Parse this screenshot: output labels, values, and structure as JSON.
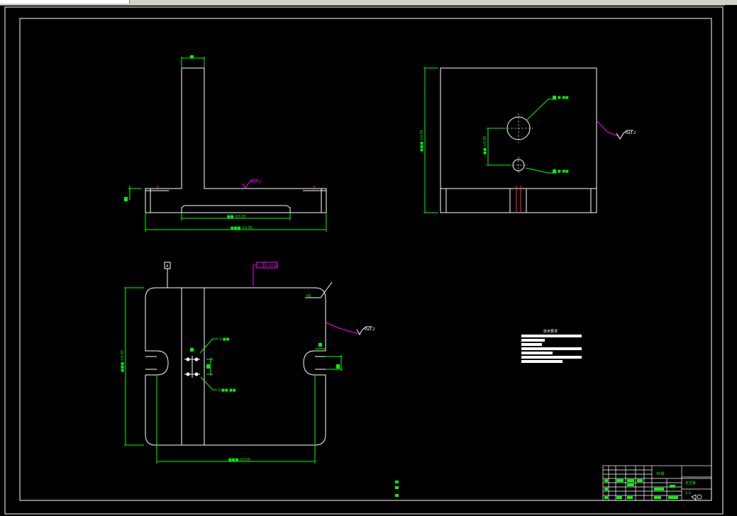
{
  "window": {
    "title": ""
  },
  "colors": {
    "background": "#000000",
    "geometry": "#ffffff",
    "dimension": "#00ff00",
    "annotation": "#ff00ff",
    "ui_chrome": "#d4d0c8"
  },
  "views": {
    "front": {
      "dim_inner": "■■ ±0.05",
      "dim_outer": "■■■ ±0.05",
      "roughness": "Ra3.2"
    },
    "side": {
      "dim_height": "■■■ ±0.05",
      "hole_top": "■ ■■",
      "hole_bottom": "■ ■■",
      "hole_spacing": "■■ ±0.05",
      "roughness": "Ra3.2"
    },
    "top": {
      "datum": "A",
      "flatness": "0.02 A",
      "roughness_right": "Ra3.2",
      "corner_note": "R5",
      "dim_width": "■■■ ±0.05",
      "dim_height": "■■■ ±0.05",
      "hole_callout_top": "2-■■",
      "hole_callout_bottom": "2-■■ ■■"
    }
  },
  "tech_notes": {
    "title": "技术要求"
  },
  "title_block": {
    "part_name": "定位板",
    "material": "45钢",
    "scale": "1:1"
  }
}
